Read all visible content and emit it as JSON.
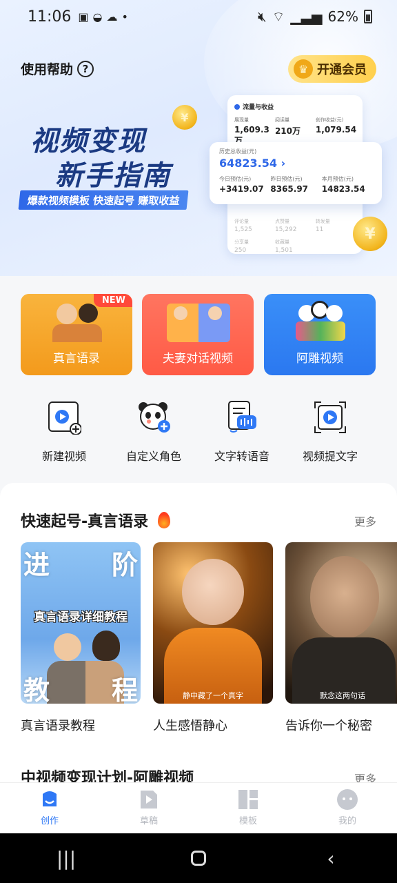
{
  "status_bar": {
    "time": "11:06",
    "battery": "62%"
  },
  "header": {
    "help_label": "使用帮助",
    "vip_label": "开通会员"
  },
  "banner": {
    "headline_line1": "视频变现",
    "headline_line2": "新手指南",
    "tagline": "爆款视频模板  快速起号  赚取收益",
    "back_card": {
      "title": "流量与收益",
      "stats": [
        {
          "label": "展现量",
          "value": "1,609.3万"
        },
        {
          "label": "阅读量",
          "value": "210万"
        },
        {
          "label": "创作收益(元)",
          "value": "1,079.54"
        }
      ],
      "faded_stats": [
        {
          "label": "评论量",
          "value": "1,525"
        },
        {
          "label": "点赞量",
          "value": "15,292"
        },
        {
          "label": "转发量",
          "value": "11"
        }
      ],
      "faded_stats2": [
        {
          "label": "分享量",
          "value": "250"
        },
        {
          "label": "收藏量",
          "value": "1,501"
        },
        {
          "label": "",
          "value": ""
        }
      ]
    },
    "front_card": {
      "label": "历史总收益(元)",
      "total": "64823.54 ›",
      "stats": [
        {
          "label": "今日预估(元)",
          "value": "+3419.07"
        },
        {
          "label": "昨日预估(元)",
          "value": "8365.97"
        },
        {
          "label": "本月预估(元)",
          "value": "14823.54"
        }
      ]
    }
  },
  "features": [
    {
      "label": "真言语录",
      "badge": "NEW"
    },
    {
      "label": "夫妻对话视频"
    },
    {
      "label": "阿雕视频"
    }
  ],
  "tools": [
    {
      "label": "新建视频"
    },
    {
      "label": "自定义角色"
    },
    {
      "label": "文字转语音"
    },
    {
      "label": "视频提文字"
    }
  ],
  "section1": {
    "title": "快速起号-真言语录",
    "more": "更多",
    "items": [
      {
        "caption": "真言语录教程",
        "overlay_top_left": "进",
        "overlay_top_right": "阶",
        "overlay_mid": "真言语录详细教程",
        "overlay_bottom_left": "教",
        "overlay_bottom_right": "程"
      },
      {
        "caption": "人生感悟静心",
        "overlay": "静中藏了一个真字"
      },
      {
        "caption": "告诉你一个秘密",
        "overlay": "默念这两句话"
      }
    ]
  },
  "section2": {
    "title": "中视频变现计划-阿雕视频",
    "more": "更多"
  },
  "bottom_nav": [
    {
      "label": "创作",
      "active": true
    },
    {
      "label": "草稿"
    },
    {
      "label": "模板"
    },
    {
      "label": "我的"
    }
  ],
  "colors": {
    "accent": "#2f78f5",
    "tile_orange": "#f5a125",
    "tile_red": "#ff6250",
    "tile_blue": "#3388f5"
  }
}
